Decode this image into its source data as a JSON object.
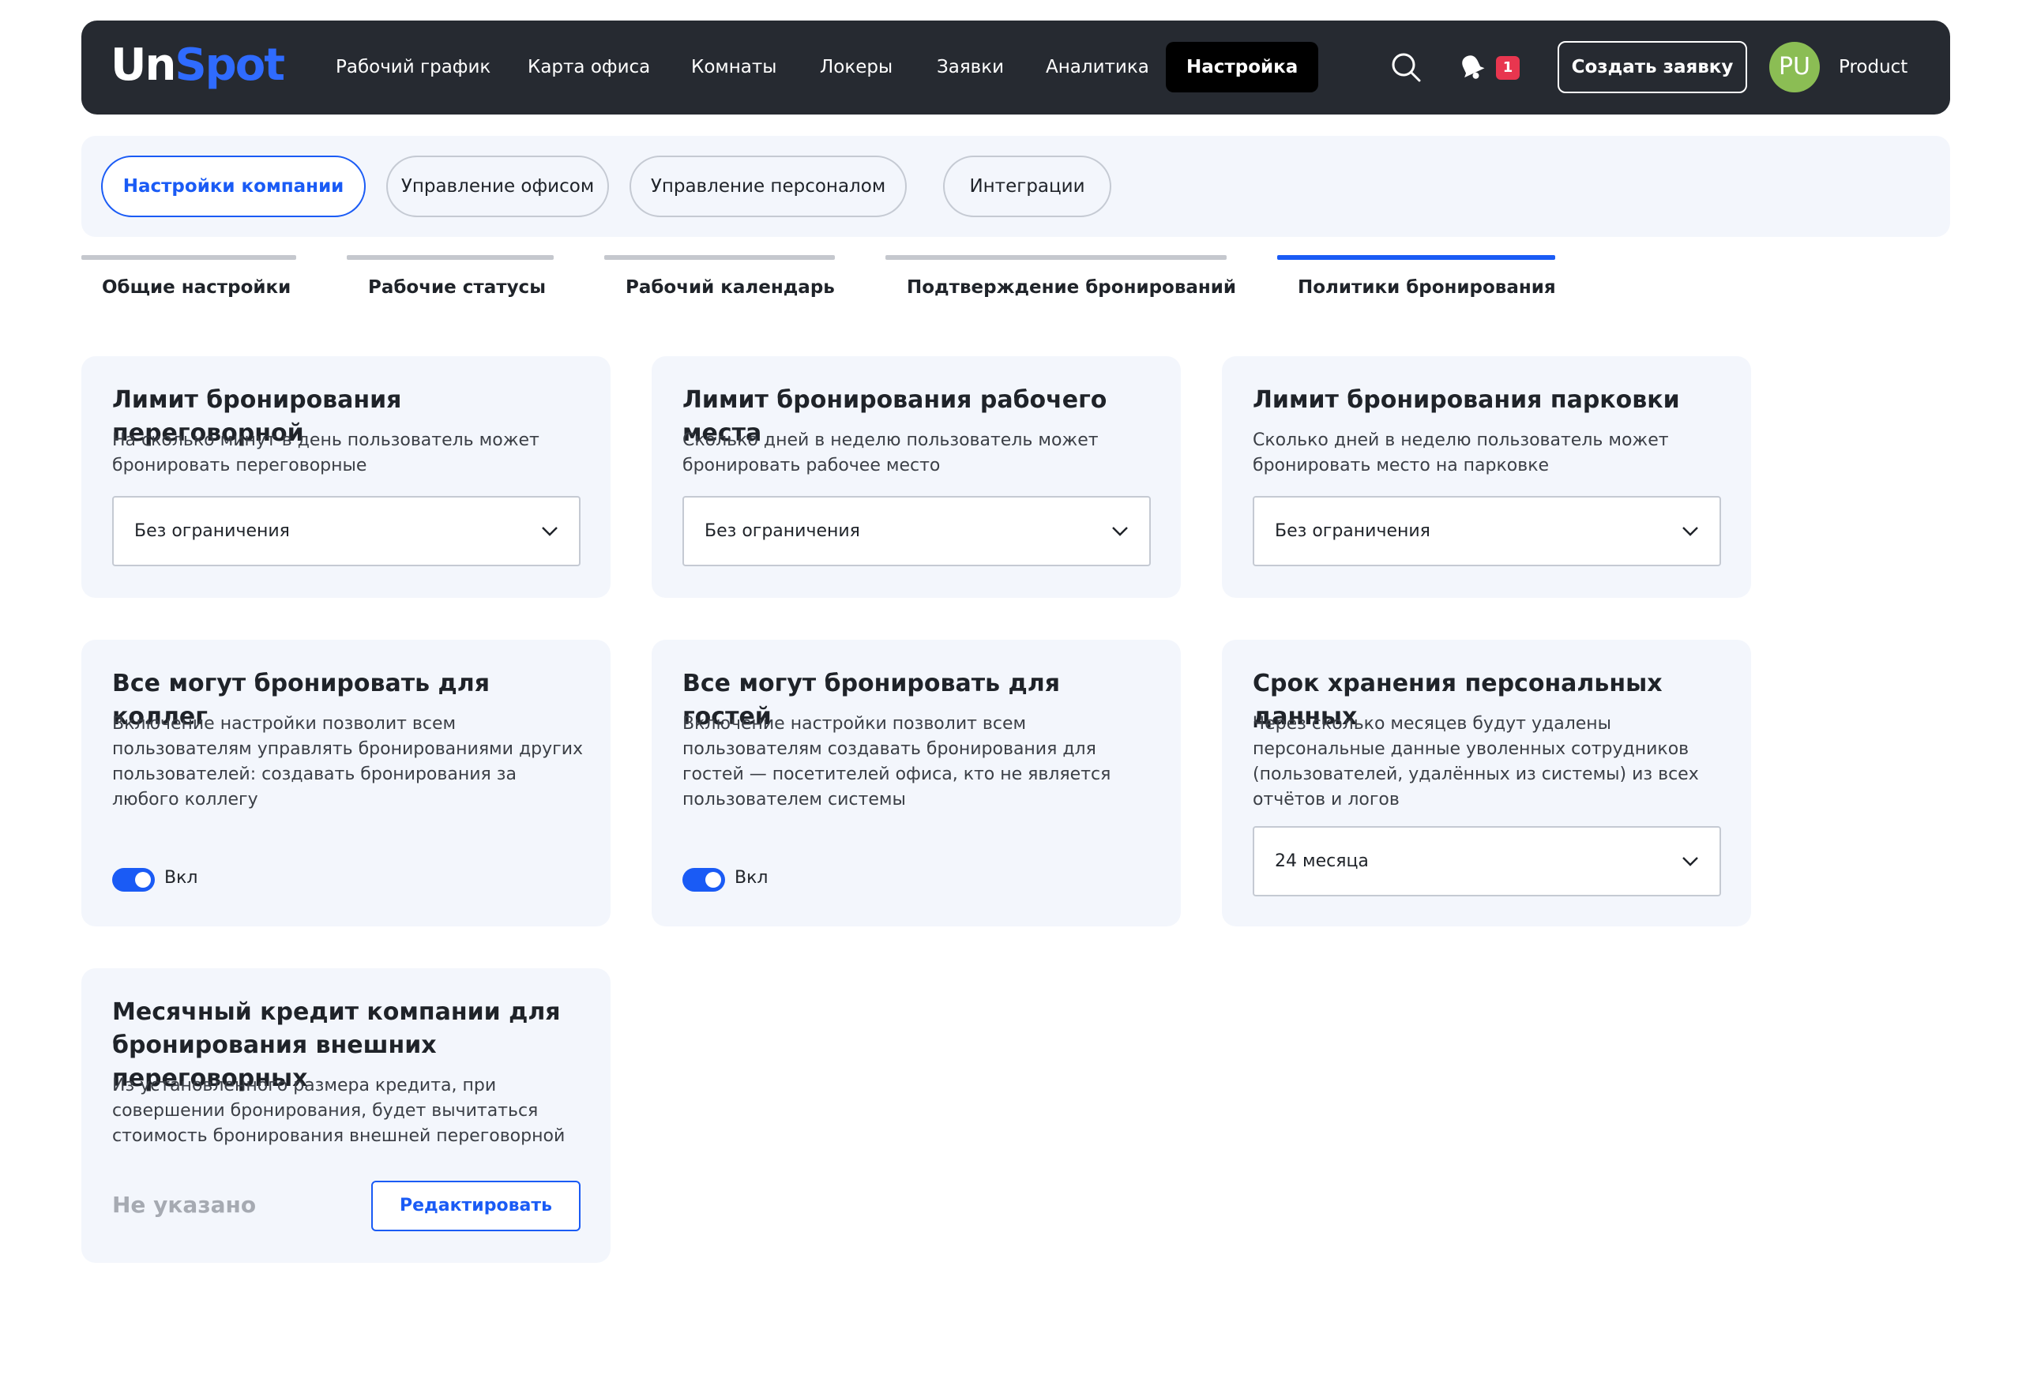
{
  "header": {
    "logo_un": "Un",
    "logo_spot": "Spot",
    "nav": [
      "Рабочий график",
      "Карта офиса",
      "Комнаты",
      "Локеры",
      "Заявки",
      "Аналитика",
      "Настройка"
    ],
    "notification_count": "1",
    "create_button": "Создать заявку",
    "avatar_initials": "PU",
    "user_name": "Product"
  },
  "sections": [
    "Настройки компании",
    "Управление офисом",
    "Управление персоналом",
    "Интеграции"
  ],
  "subtabs": [
    "Общие настройки",
    "Рабочие статусы",
    "Рабочий календарь",
    "Подтверждение бронирований",
    "Политики бронирования"
  ],
  "cards": {
    "meeting_limit": {
      "title": "Лимит бронирования переговорной",
      "desc": "На сколько минут в день пользователь может бронировать переговорные",
      "value": "Без ограничения"
    },
    "desk_limit": {
      "title": "Лимит бронирования рабочего места",
      "desc": "Сколько дней в неделю пользователь может бронировать рабочее место",
      "value": "Без ограничения"
    },
    "parking_limit": {
      "title": "Лимит бронирования парковки",
      "desc": "Сколько дней в неделю пользователь может бронировать место на парковке",
      "value": "Без ограничения"
    },
    "book_for_colleagues": {
      "title": "Все могут бронировать для коллег",
      "desc": "Включение настройки позволит всем пользователям управлять бронированиями других пользователей: создавать бронирования за любого коллегу",
      "toggle_label": "Вкл"
    },
    "book_for_guests": {
      "title": "Все могут бронировать для гостей",
      "desc": "Включение настройки позволит всем пользователям создавать бронирования для гостей — посетителей офиса, кто не является пользователем системы",
      "toggle_label": "Вкл"
    },
    "data_retention": {
      "title": "Срок хранения персональных данных",
      "desc": "Через сколько месяцев будут удалены персональные данные уволенных сотрудников (пользователей, удалённых из системы) из всех отчётов и логов",
      "value": "24 месяца"
    },
    "monthly_credit": {
      "title": "Месячный кредит компании для бронирования внешних переговорных",
      "desc": "Из установленного размера кредита, при совершении бронирования, будет вычитаться стоимость бронирования внешней переговорной",
      "value": "Не указано",
      "edit_button": "Редактировать"
    }
  },
  "colors": {
    "topbar": "#262a31",
    "accent": "#1a5bf5",
    "card_bg": "#f3f6fc",
    "badge": "#e8364f",
    "avatar": "#8bbd54"
  }
}
